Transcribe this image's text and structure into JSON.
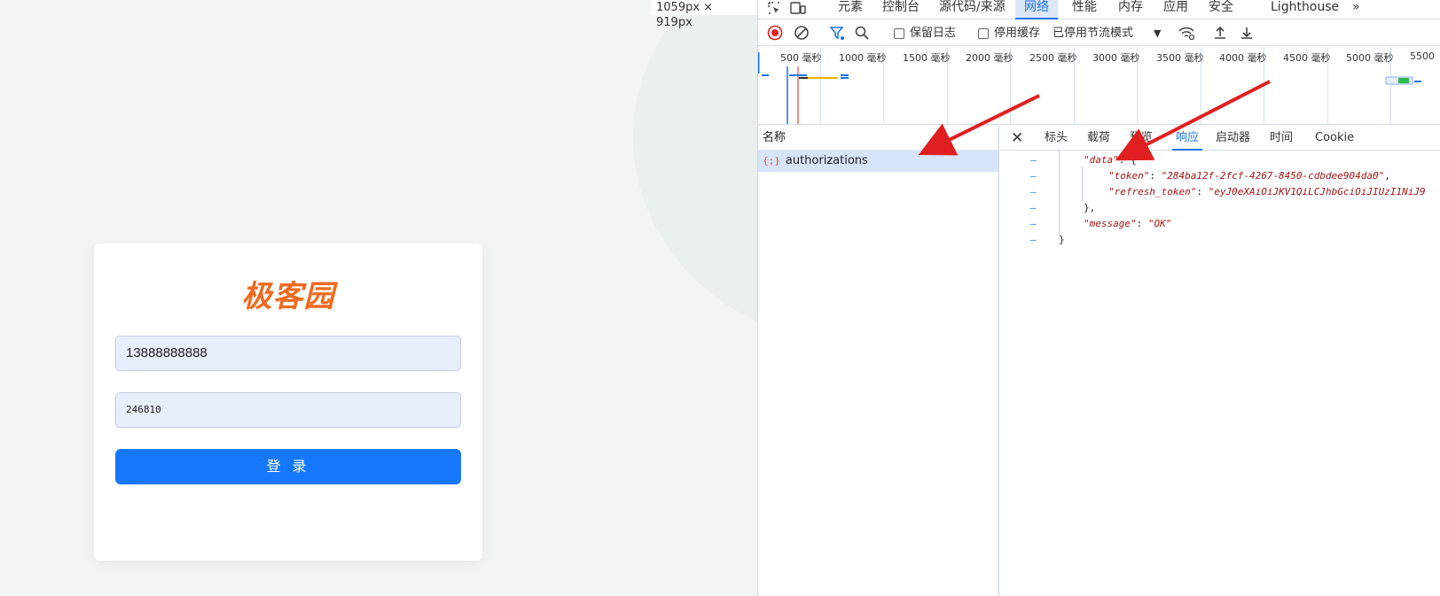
{
  "page": {
    "viewport_badge": "1059px × 919px",
    "logo": "极客园",
    "phone_value": "13888888888",
    "code_value": "246810",
    "login_label": "登 录"
  },
  "devtools": {
    "tabs": [
      "元素",
      "控制台",
      "源代码/来源",
      "网络",
      "性能",
      "内存",
      "应用",
      "安全",
      "Lighthouse"
    ],
    "active_tab": "网络",
    "toolbar": {
      "preserve_log": "保留日志",
      "disable_cache": "停用缓存",
      "throttling": "已停用节流模式"
    },
    "timeline_ticks": [
      "500 毫秒",
      "1000 毫秒",
      "1500 毫秒",
      "2000 毫秒",
      "2500 毫秒",
      "3000 毫秒",
      "3500 毫秒",
      "4000 毫秒",
      "4500 毫秒",
      "5000 毫秒",
      "5500"
    ],
    "name_header": "名称",
    "request": {
      "icon": "{;}",
      "name": "authorizations"
    },
    "detail_tabs": [
      "标头",
      "载荷",
      "预览",
      "响应",
      "启动器",
      "时间",
      "Cookie"
    ],
    "active_detail_tab": "响应",
    "response": {
      "data_key": "\"data\"",
      "token_key": "\"token\"",
      "token_value": "\"284ba12f-2fcf-4267-8450-cdbdee904da0\"",
      "refresh_key": "\"refresh_token\"",
      "refresh_value": "\"eyJ0eXAiOiJKV1QiLCJhbGciOiJIUzI1NiJ9",
      "message_key": "\"message\"",
      "message_value": "\"OK\""
    }
  },
  "colors": {
    "accent": "#1677ff",
    "logo": "#f06a1f",
    "arrow": "#e02020"
  }
}
